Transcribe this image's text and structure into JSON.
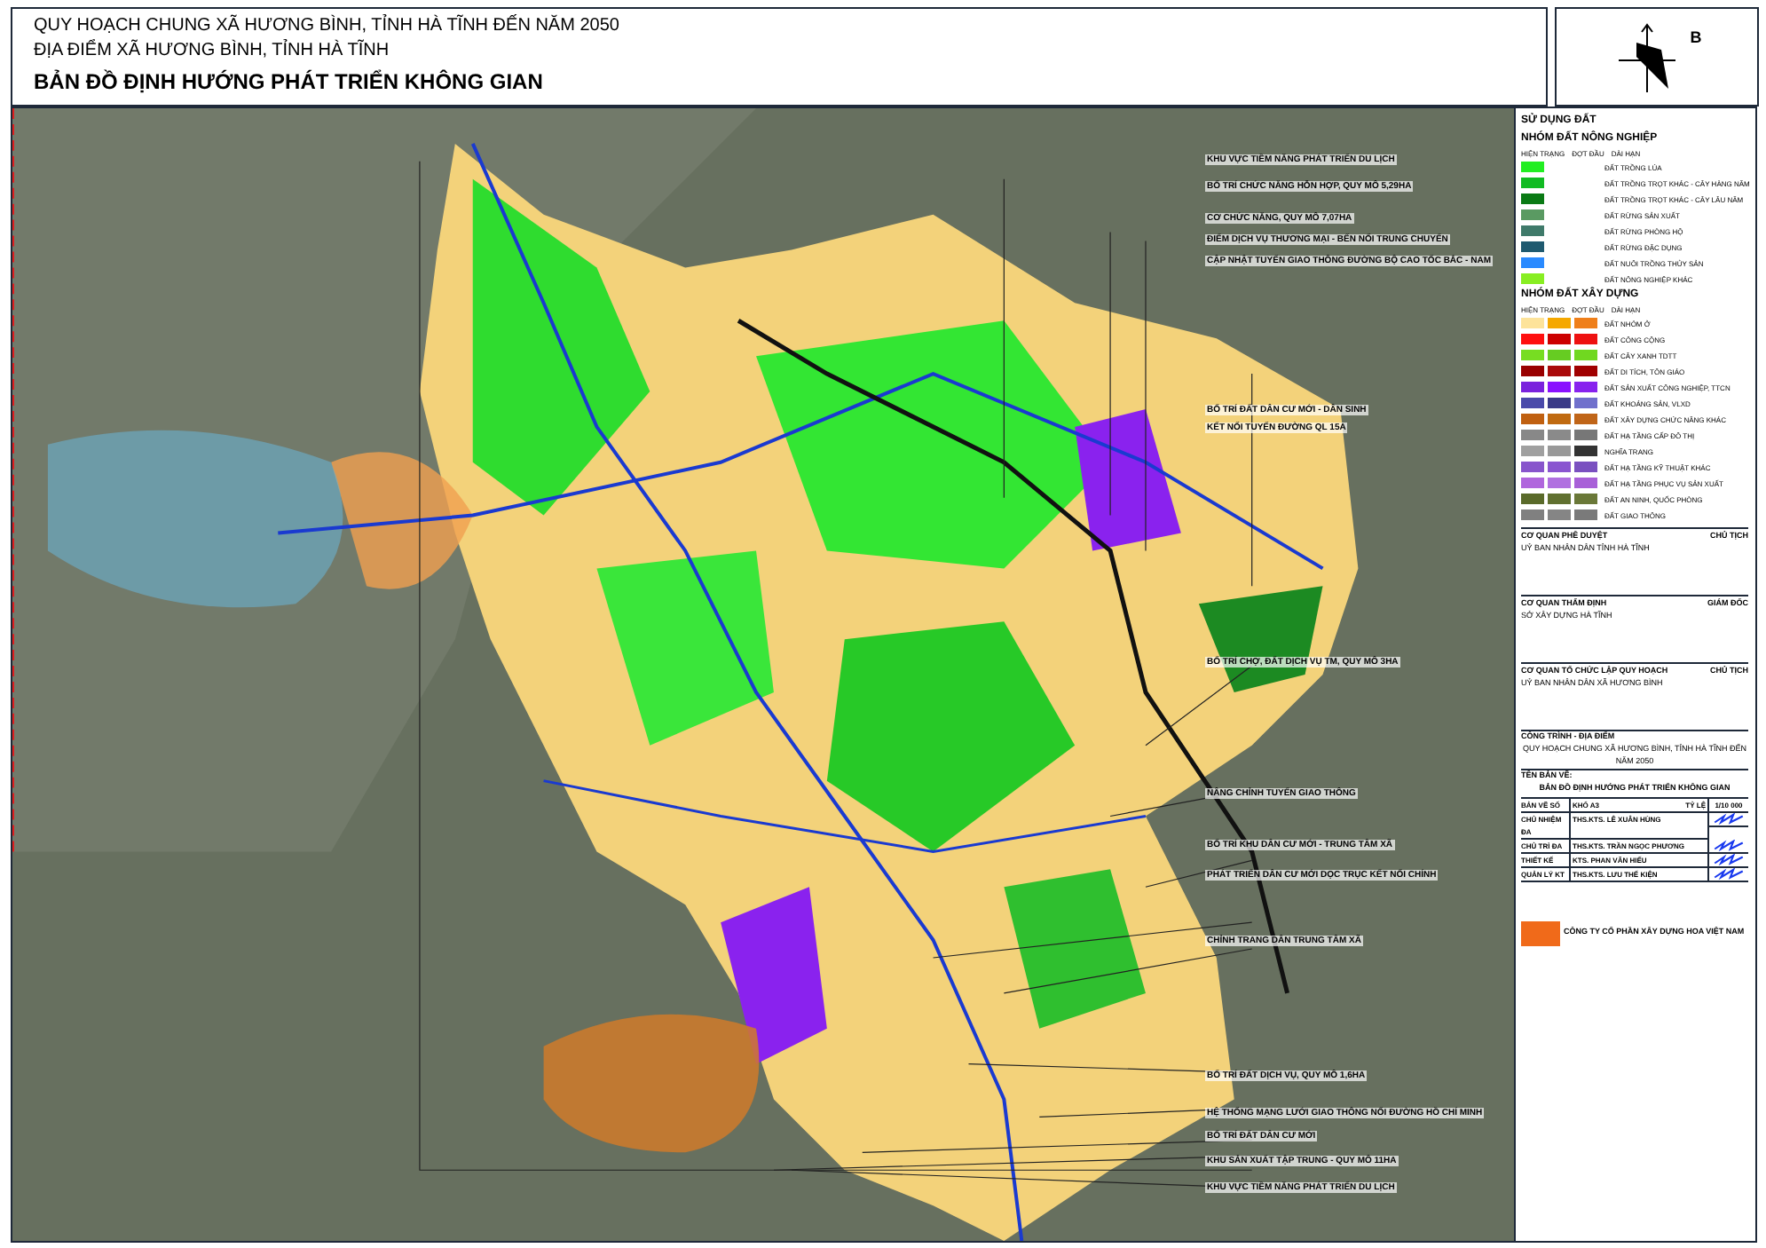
{
  "header": {
    "lines": [
      "QUY HOẠCH CHUNG XÃ HƯƠNG BÌNH, TỈNH HÀ TĨNH ĐẾN NĂM 2050",
      "ĐỊA ĐIỂM XÃ HƯƠNG BÌNH, TỈNH HÀ TĨNH"
    ],
    "title": "BẢN ĐỒ ĐỊNH HƯỚNG PHÁT TRIỂN KHÔNG GIAN"
  },
  "north_arrow": {
    "label": "B"
  },
  "map": {
    "callouts": [
      "KHU VỰC TIỀM NĂNG PHÁT TRIỂN DU LỊCH",
      "BỐ TRÍ CHỨC NĂNG HỖN HỢP, QUY MÔ 5,29HA",
      "CƠ CHỨC NĂNG, QUY MÔ 7,07HA",
      "ĐIỂM DỊCH VỤ THƯƠNG MẠI - BẾN NỐI TRUNG CHUYỂN",
      "CẬP NHẬT TUYẾN GIAO THÔNG ĐƯỜNG BỘ CAO TỐC BẮC - NAM",
      "BỐ TRÍ ĐẤT DÂN CƯ MỚI - DÂN SINH",
      "KẾT NỐI TUYẾN ĐƯỜNG QL 15A",
      "BỐ TRÍ CHỢ, ĐẤT DỊCH VỤ TM, QUY MÔ 3HA",
      "NÂNG CHỈNH TUYẾN GIAO THÔNG",
      "BỐ TRÍ KHU DÂN CƯ MỚI - TRUNG TÂM XÃ",
      "PHÁT TRIỂN DÂN CƯ MỚI DỌC TRỤC KẾT NỐI CHÍNH",
      "CHỈNH TRANG DÂN TRUNG TÂM XÃ",
      "BỐ TRÍ ĐẤT DỊCH VỤ, QUY MÔ 1,6HA",
      "HỆ THỐNG MẠNG LƯỚI GIAO THÔNG NỐI ĐƯỜNG HỒ CHÍ MINH",
      "BỐ TRÍ ĐẤT DÂN CƯ MỚI",
      "KHU SẢN XUẤT TẬP TRUNG - QUY MÔ 11HA",
      "KHU VỰC TIỀM NĂNG PHÁT TRIỂN DU LỊCH"
    ]
  },
  "legend": {
    "title": "SỬ DỤNG ĐẤT",
    "groups": [
      {
        "title": "NHÓM ĐẤT NÔNG NGHIỆP",
        "columns": [
          "HIỆN TRẠNG",
          "ĐỢT ĐẦU",
          "DÀI HẠN"
        ],
        "items": [
          {
            "label": "ĐẤT TRỒNG LÚA",
            "swatches": [
              {
                "color": "#22ee22"
              }
            ]
          },
          {
            "label": "ĐẤT TRỒNG TRỌT KHÁC - CÂY HÀNG NĂM",
            "swatches": [
              {
                "color": "#11bb22"
              }
            ]
          },
          {
            "label": "ĐẤT TRỒNG TRỌT KHÁC - CÂY LÂU NĂM",
            "swatches": [
              {
                "color": "#0a7a14"
              }
            ]
          },
          {
            "label": "ĐẤT RỪNG SẢN XUẤT",
            "swatches": [
              {
                "color": "#5a9a62"
              }
            ]
          },
          {
            "label": "ĐẤT RỪNG PHÒNG HỘ",
            "swatches": [
              {
                "color": "#3f7a6a"
              }
            ]
          },
          {
            "label": "ĐẤT RỪNG ĐẶC DỤNG",
            "swatches": [
              {
                "color": "#1f5a70"
              }
            ]
          },
          {
            "label": "ĐẤT NUÔI TRỒNG THỦY SẢN",
            "swatches": [
              {
                "color": "#2a8aff"
              }
            ]
          },
          {
            "label": "ĐẤT NÔNG NGHIỆP KHÁC",
            "swatches": [
              {
                "color": "#88ee22"
              }
            ]
          }
        ]
      },
      {
        "title": "NHÓM ĐẤT XÂY DỰNG",
        "columns": [
          "HIỆN TRẠNG",
          "ĐỢT ĐẦU",
          "DÀI HẠN"
        ],
        "items": [
          {
            "label": "ĐẤT NHÓM Ở",
            "swatches": [
              {
                "color": "#fde39a"
              },
              {
                "color": "#f5a800"
              },
              {
                "color": "#ef7f1a"
              }
            ]
          },
          {
            "label": "ĐẤT CÔNG CỘNG",
            "swatches": [
              {
                "color": "#ff1010"
              },
              {
                "color": "#cc0000"
              },
              {
                "color": "#ee1111"
              }
            ]
          },
          {
            "label": "ĐẤT CÂY XANH TDTT",
            "swatches": [
              {
                "color": "#77dd22"
              },
              {
                "color": "#66cc22"
              },
              {
                "color": "#70d820"
              }
            ]
          },
          {
            "label": "ĐẤT DI TÍCH, TÔN GIÁO",
            "swatches": [
              {
                "color": "#990000"
              },
              {
                "color": "#aa0a0a"
              },
              {
                "color": "#a00000"
              }
            ]
          },
          {
            "label": "ĐẤT SẢN XUẤT CÔNG NGHIỆP, TTCN",
            "swatches": [
              {
                "color": "#7a22dd"
              },
              {
                "color": "#8a11ff"
              },
              {
                "color": "#8822ee"
              }
            ]
          },
          {
            "label": "ĐẤT KHOÁNG SẢN, VLXD",
            "swatches": [
              {
                "color": "#4a4aaa"
              },
              {
                "color": "#3a3a88"
              },
              {
                "color": "#7070cc"
              }
            ]
          },
          {
            "label": "ĐẤT XÂY DỰNG CHỨC NĂNG KHÁC",
            "swatches": [
              {
                "color": "#c06010"
              },
              {
                "color": "#c06a10"
              },
              {
                "color": "#c06518"
              }
            ]
          },
          {
            "label": "ĐẤT HẠ TẦNG CẤP ĐÔ THỊ",
            "swatches": [
              {
                "color": "#888888"
              },
              {
                "color": "#8a8a8a"
              },
              {
                "color": "#777777"
              }
            ]
          },
          {
            "label": "NGHĨA TRANG",
            "swatches": [
              {
                "color": "#a0a0a0"
              },
              {
                "color": "#999999"
              },
              {
                "color": "#333333"
              }
            ]
          },
          {
            "label": "ĐẤT HẠ TẦNG KỸ THUẬT KHÁC",
            "swatches": [
              {
                "color": "#8855cc"
              },
              {
                "color": "#8a55d0"
              },
              {
                "color": "#7a50c0"
              }
            ]
          },
          {
            "label": "ĐẤT HẠ TẦNG PHỤC VỤ SẢN XUẤT",
            "swatches": [
              {
                "color": "#b066dd"
              },
              {
                "color": "#b070e0"
              },
              {
                "color": "#a860d8"
              }
            ]
          },
          {
            "label": "ĐẤT AN NINH, QUỐC PHÒNG",
            "swatches": [
              {
                "color": "#5a6a2a"
              },
              {
                "color": "#607030"
              },
              {
                "color": "#6a7838"
              }
            ]
          },
          {
            "label": "ĐẤT GIAO THÔNG",
            "swatches": [
              {
                "color": "#808080"
              },
              {
                "color": "#858585"
              },
              {
                "color": "#7a7a7a"
              }
            ]
          }
        ]
      }
    ]
  },
  "approvals": [
    {
      "heading": "CƠ QUAN PHÊ DUYỆT",
      "role": "CHỦ TỊCH",
      "org": "UỶ BAN NHÂN DÂN TỈNH HÀ TĨNH"
    },
    {
      "heading": "CƠ QUAN THẨM ĐỊNH",
      "role": "GIÁM ĐỐC",
      "org": "SỞ XÂY DỰNG HÀ TĨNH"
    },
    {
      "heading": "CƠ QUAN TỔ CHỨC LẬP QUY HOẠCH",
      "role": "CHỦ TỊCH",
      "org": "UỶ BAN NHÂN DÂN XÃ HƯƠNG BÌNH"
    }
  ],
  "project": {
    "heading": "CÔNG TRÌNH - ĐỊA ĐIỂM",
    "name": "QUY HOẠCH CHUNG XÃ HƯƠNG BÌNH, TỈNH HÀ TĨNH ĐẾN NĂM 2050",
    "drawing_heading": "TÊN BẢN VẼ:",
    "drawing_name": "BẢN ĐỒ ĐỊNH HƯỚNG PHÁT TRIỂN KHÔNG GIAN"
  },
  "staff_table": {
    "header": [
      "BẢN VẼ SỐ",
      "KHỔ A3",
      "TỶ LỆ",
      "1/10 000"
    ],
    "rows": [
      [
        "CHỦ NHIỆM ĐA",
        "THS.KTS. LÊ XUÂN HÙNG"
      ],
      [
        "CHỦ TRÌ ĐA",
        "THS.KTS. TRẦN NGỌC PHƯƠNG"
      ],
      [
        "THIẾT KẾ",
        "KTS. PHAN VĂN HIẾU"
      ],
      [
        "QUẢN LÝ KT",
        "THS.KTS. LƯU THẾ KIỆN"
      ]
    ]
  },
  "company": {
    "name": "CÔNG TY CỔ PHẦN XÂY DỰNG HOA VIỆT NAM"
  }
}
